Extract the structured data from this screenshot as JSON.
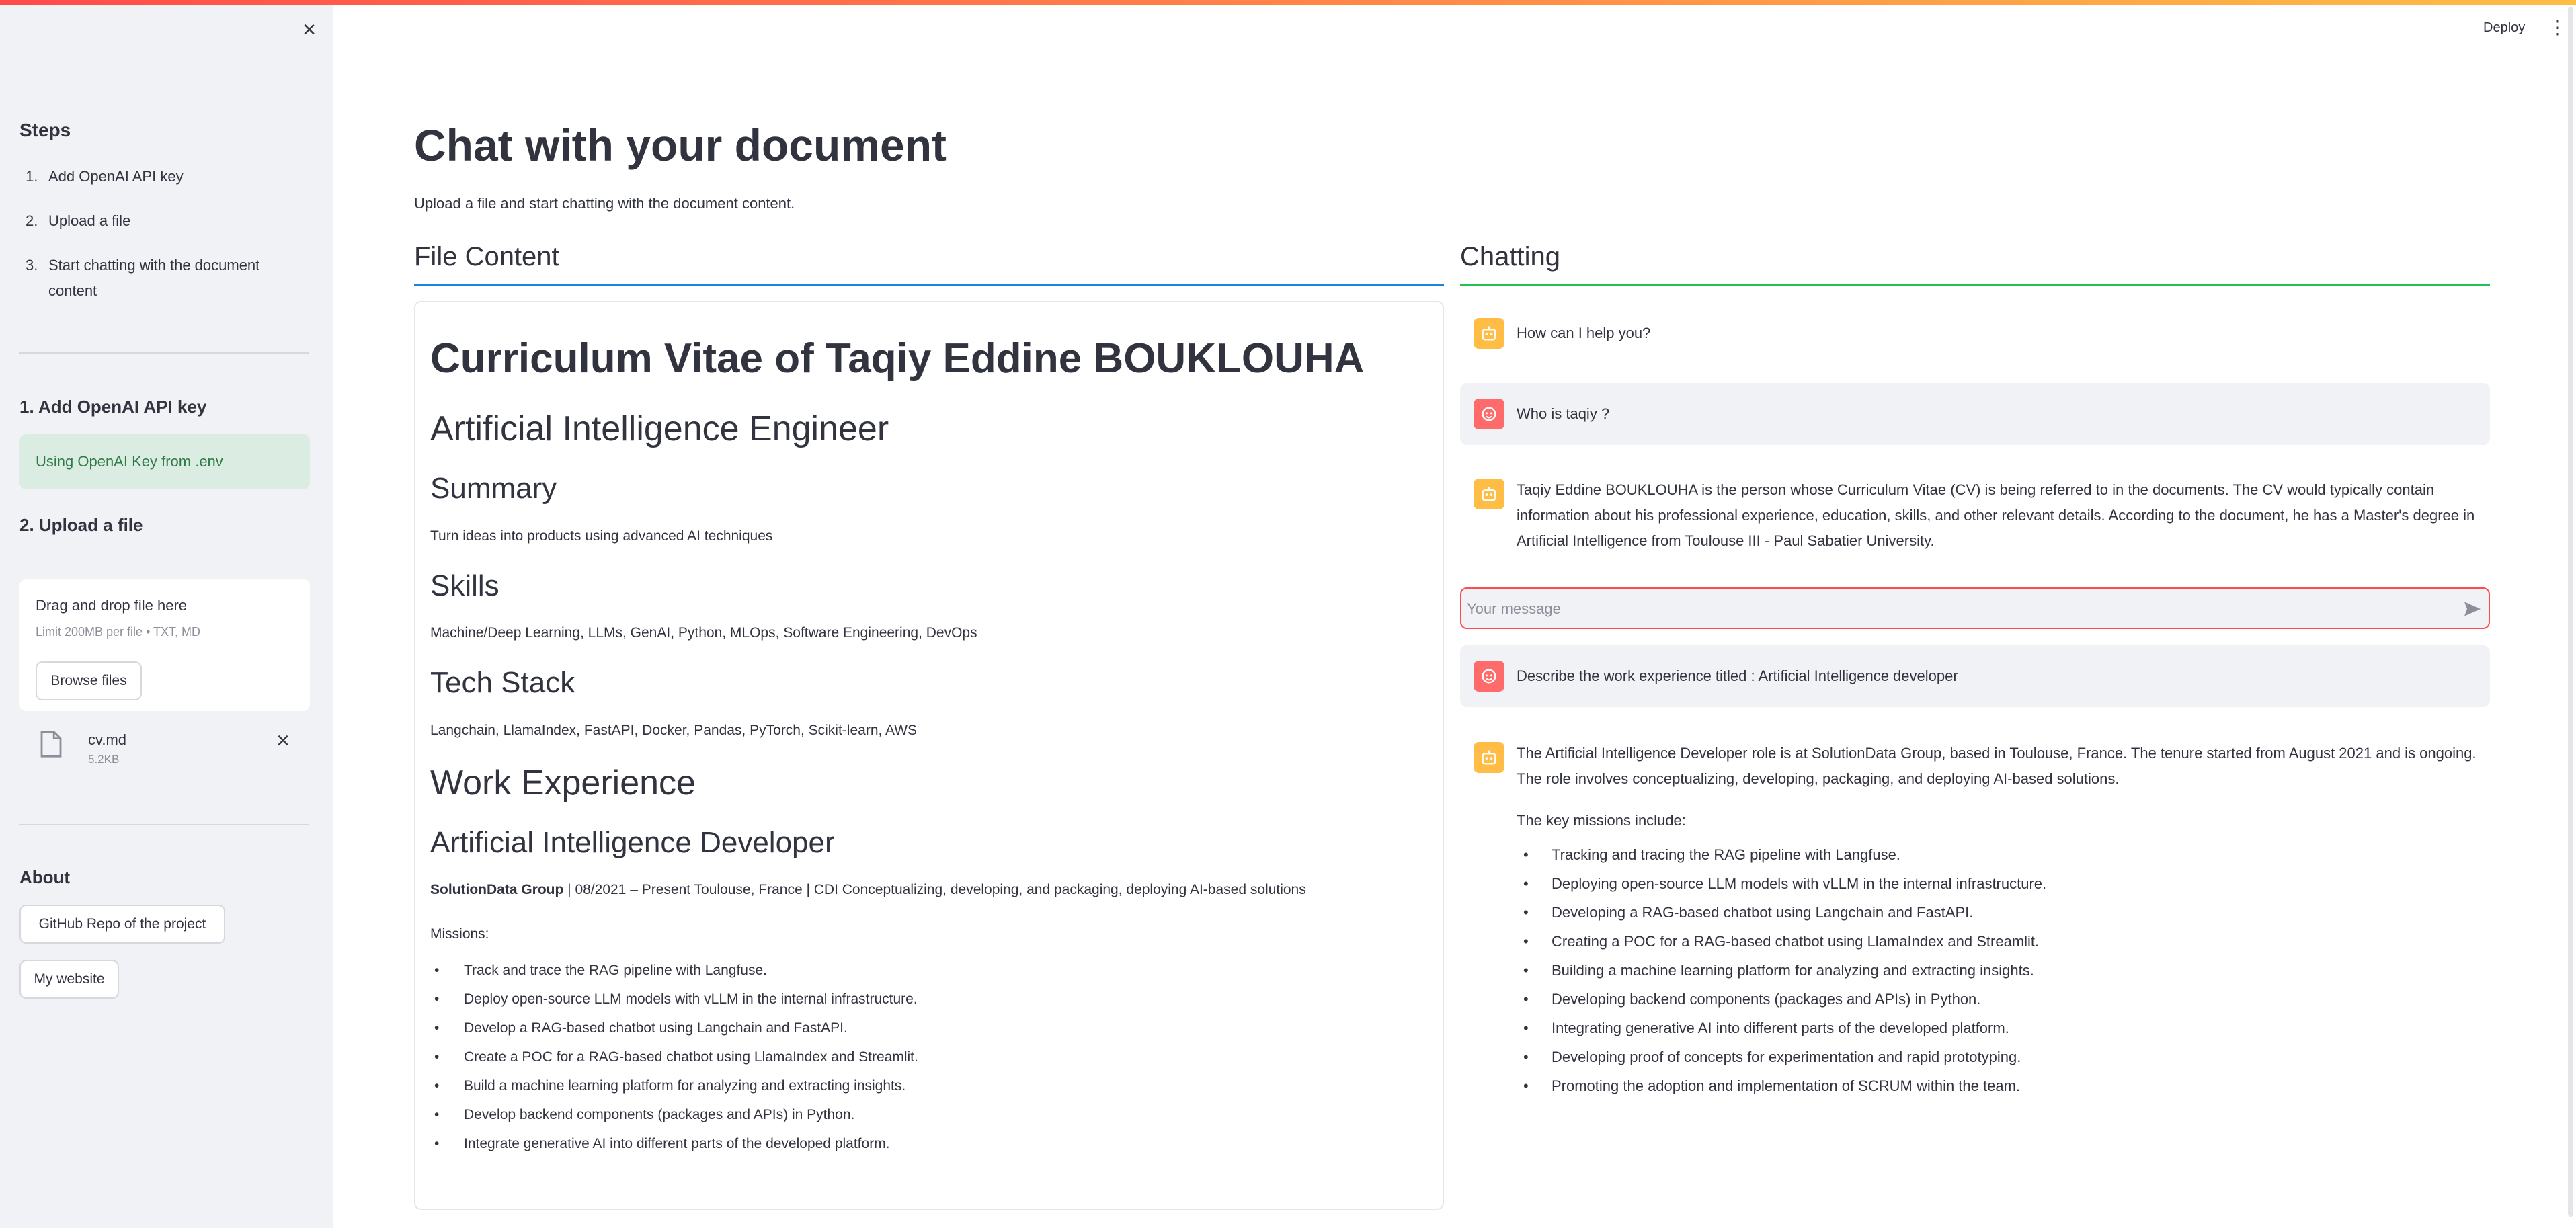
{
  "header": {
    "deploy_label": "Deploy",
    "more_icon": "vertical-dots-icon"
  },
  "sidebar": {
    "close_icon": "close-icon",
    "steps_title": "Steps",
    "steps": [
      {
        "num": "1.",
        "label": "Add OpenAI API key"
      },
      {
        "num": "2.",
        "label": "Upload a file"
      },
      {
        "num": "3.",
        "label": "Start chatting with the document content"
      }
    ],
    "section1_title": "1. Add OpenAI API key",
    "success_message": "Using OpenAI Key from .env",
    "section2_title": "2. Upload a file",
    "uploader": {
      "drag_text": "Drag and drop file here",
      "limit_text": "Limit 200MB per file • TXT, MD",
      "browse_label": "Browse files"
    },
    "uploaded_file": {
      "name": "cv.md",
      "size": "5.2KB"
    },
    "about_title": "About",
    "github_label": "GitHub Repo of the project",
    "website_label": "My website"
  },
  "main": {
    "title": "Chat with your document",
    "subtitle": "Upload a file and start chatting with the document content.",
    "file_content_header": "File Content",
    "chatting_header": "Chatting"
  },
  "document": {
    "h1": "Curriculum Vitae of Taqiy Eddine BOUKLOUHA",
    "role_h2": "Artificial Intelligence Engineer",
    "summary_h3": "Summary",
    "summary_text": "Turn ideas into products using advanced AI techniques",
    "skills_h3": "Skills",
    "skills_text": "Machine/Deep Learning, LLMs, GenAI, Python, MLOps, Software Engineering, DevOps",
    "stack_h3": "Tech Stack",
    "stack_text": "Langchain, LlamaIndex, FastAPI, Docker, Pandas, PyTorch, Scikit-learn, AWS",
    "work_h2": "Work Experience",
    "job_h3": "Artificial Intelligence Developer",
    "job_company": "SolutionData Group",
    "job_details": " | 08/2021 – Present Toulouse, France | CDI Conceptualizing, developing, and packaging, deploying AI-based solutions",
    "missions_label": "Missions:",
    "missions": [
      "Track and trace the RAG pipeline with Langfuse.",
      "Deploy open-source LLM models with vLLM in the internal infrastructure.",
      "Develop a RAG-based chatbot using Langchain and FastAPI.",
      "Create a POC for a RAG-based chatbot using LlamaIndex and Streamlit.",
      "Build a machine learning platform for analyzing and extracting insights.",
      "Develop backend components (packages and APIs) in Python.",
      "Integrate generative AI into different parts of the developed platform."
    ]
  },
  "chat": {
    "messages": [
      {
        "role": "assistant",
        "text": "How can I help you?"
      },
      {
        "role": "user",
        "text": "Who is taqiy ?"
      },
      {
        "role": "assistant",
        "text": "Taqiy Eddine BOUKLOUHA is the person whose Curriculum Vitae (CV) is being referred to in the documents. The CV would typically contain information about his professional experience, education, skills, and other relevant details. According to the document, he has a Master's degree in Artificial Intelligence from Toulouse III - Paul Sabatier University."
      },
      {
        "role": "user",
        "text": "Describe the work experience titled : Artificial Intelligence developer"
      },
      {
        "role": "assistant",
        "text": "The Artificial Intelligence Developer role is at SolutionData Group, based in Toulouse, France. The tenure started from August 2021 and is ongoing. The role involves conceptualizing, developing, packaging, and deploying AI-based solutions.",
        "intro": "The key missions include:",
        "bullets": [
          "Tracking and tracing the RAG pipeline with Langfuse.",
          "Deploying open-source LLM models with vLLM in the internal infrastructure.",
          "Developing a RAG-based chatbot using Langchain and FastAPI.",
          "Creating a POC for a RAG-based chatbot using LlamaIndex and Streamlit.",
          "Building a machine learning platform for analyzing and extracting insights.",
          "Developing backend components (packages and APIs) in Python.",
          "Integrating generative AI into different parts of the developed platform.",
          "Developing proof of concepts for experimentation and rapid prototyping.",
          "Promoting the adoption and implementation of SCRUM within the team."
        ]
      }
    ],
    "input_placeholder": "Your message",
    "input_value": ""
  },
  "colors": {
    "primary": "#ff4b4b",
    "file_header_line": "#1c83e1",
    "chat_header_line": "#21c354",
    "sidebar_bg": "#f0f2f6",
    "success_bg": "#dbede2",
    "bot_avatar": "#ffbd45",
    "user_avatar": "#ff6b6b"
  }
}
